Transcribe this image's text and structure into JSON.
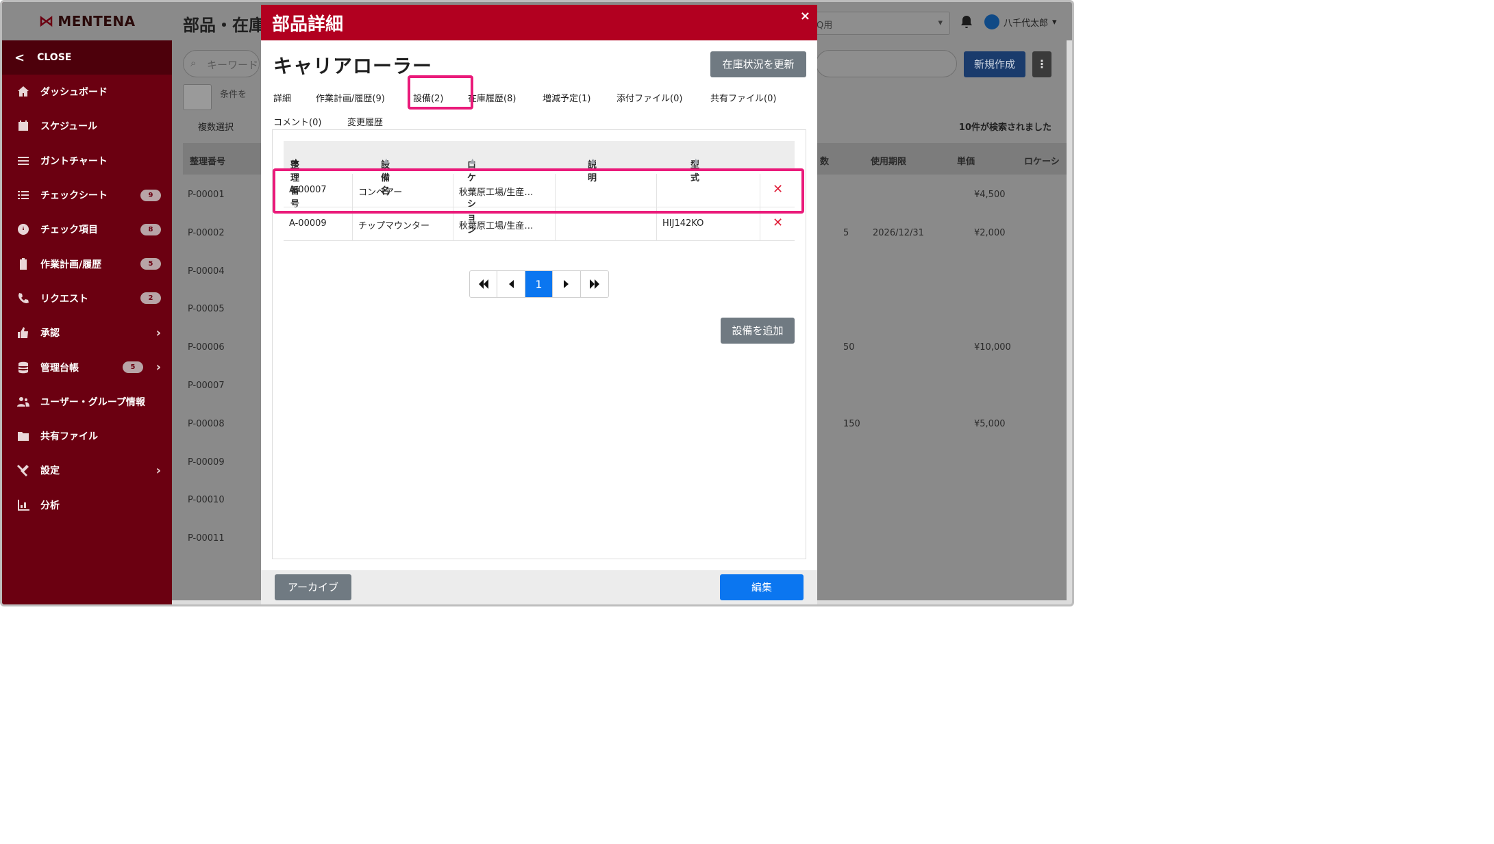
{
  "app": {
    "logo": "MENTENA",
    "close_label": "CLOSE"
  },
  "sidebar": {
    "items": [
      {
        "label": "ダッシュボード",
        "icon": "home-icon",
        "badge": null,
        "chevron": false
      },
      {
        "label": "スケジュール",
        "icon": "calendar-icon",
        "badge": null,
        "chevron": false
      },
      {
        "label": "ガントチャート",
        "icon": "list-icon",
        "badge": null,
        "chevron": false
      },
      {
        "label": "チェックシート",
        "icon": "checklist-icon",
        "badge": "9",
        "chevron": false
      },
      {
        "label": "チェック項目",
        "icon": "gauge-icon",
        "badge": "8",
        "chevron": false
      },
      {
        "label": "作業計画/履歴",
        "icon": "clipboard-icon",
        "badge": "5",
        "chevron": false
      },
      {
        "label": "リクエスト",
        "icon": "phone-icon",
        "badge": "2",
        "chevron": false
      },
      {
        "label": "承認",
        "icon": "thumbs-up-icon",
        "badge": null,
        "chevron": true
      },
      {
        "label": "管理台帳",
        "icon": "database-icon",
        "badge": "5",
        "chevron": true
      },
      {
        "label": "ユーザー・グループ情報",
        "icon": "users-icon",
        "badge": null,
        "chevron": false
      },
      {
        "label": "共有ファイル",
        "icon": "folder-icon",
        "badge": null,
        "chevron": false
      },
      {
        "label": "設定",
        "icon": "tools-icon",
        "badge": null,
        "chevron": true
      },
      {
        "label": "分析",
        "icon": "chart-icon",
        "badge": null,
        "chevron": false
      }
    ]
  },
  "background": {
    "page_title": "部品・在庫",
    "search_placeholder": "キーワード",
    "conditions_label": "条件を",
    "multi_select_label": "複数選択",
    "result_count": "10件が検索されました",
    "topbar_select": "Q用",
    "user_name": "八千代太郎",
    "new_button": "新規作成",
    "table_headers": {
      "id": "整理番号",
      "stock": "数",
      "expiry": "使用期限",
      "price": "単価",
      "location": "ロケーシ"
    },
    "rows": [
      {
        "id": "P-00001",
        "stock": "",
        "expiry": "",
        "price": "¥4,500"
      },
      {
        "id": "P-00002",
        "stock": "5",
        "expiry": "2026/12/31",
        "price": "¥2,000"
      },
      {
        "id": "P-00004",
        "stock": "",
        "expiry": "",
        "price": ""
      },
      {
        "id": "P-00005",
        "stock": "",
        "expiry": "",
        "price": ""
      },
      {
        "id": "P-00006",
        "stock": "50",
        "expiry": "",
        "price": "¥10,000"
      },
      {
        "id": "P-00007",
        "stock": "",
        "expiry": "",
        "price": ""
      },
      {
        "id": "P-00008",
        "stock": "150",
        "expiry": "",
        "price": "¥5,000"
      },
      {
        "id": "P-00009",
        "stock": "",
        "expiry": "",
        "price": ""
      },
      {
        "id": "P-00010",
        "stock": "",
        "expiry": "",
        "price": ""
      },
      {
        "id": "P-00011",
        "stock": "",
        "expiry": "",
        "price": ""
      }
    ]
  },
  "modal": {
    "title": "部品詳細",
    "close_symbol": "×",
    "part_name": "キャリアローラー",
    "update_stock_button": "在庫状況を更新",
    "tabs": [
      "詳細",
      "作業計画/履歴(9)",
      "設備(2)",
      "在庫履歴(8)",
      "増減予定(1)",
      "添付ファイル(0)",
      "共有ファイル(0)",
      "コメント(0)",
      "変更履歴"
    ],
    "active_tab": "設備(2)",
    "table": {
      "headers": [
        "整理番号",
        "設備名",
        "ロケーション",
        "説明",
        "型式"
      ],
      "rows": [
        {
          "id": "A-00007",
          "name": "コンベアー",
          "location": "秋葉原工場/生産…",
          "description": "",
          "model": ""
        },
        {
          "id": "A-00009",
          "name": "チップマウンター",
          "location": "秋葉原工場/生産…",
          "description": "",
          "model": "HIJ142KO"
        }
      ],
      "delete_symbol": "✕"
    },
    "pagination": {
      "first": "⏮",
      "prev": "◀",
      "current": "1",
      "next": "▶",
      "last": "⏭"
    },
    "add_equipment_button": "設備を追加",
    "archive_button": "アーカイブ",
    "edit_button": "編集"
  },
  "colors": {
    "sidebar": "#6b0011",
    "modal_header": "#b20020",
    "primary": "#0b76f0",
    "highlight": "#ea1a7a"
  }
}
